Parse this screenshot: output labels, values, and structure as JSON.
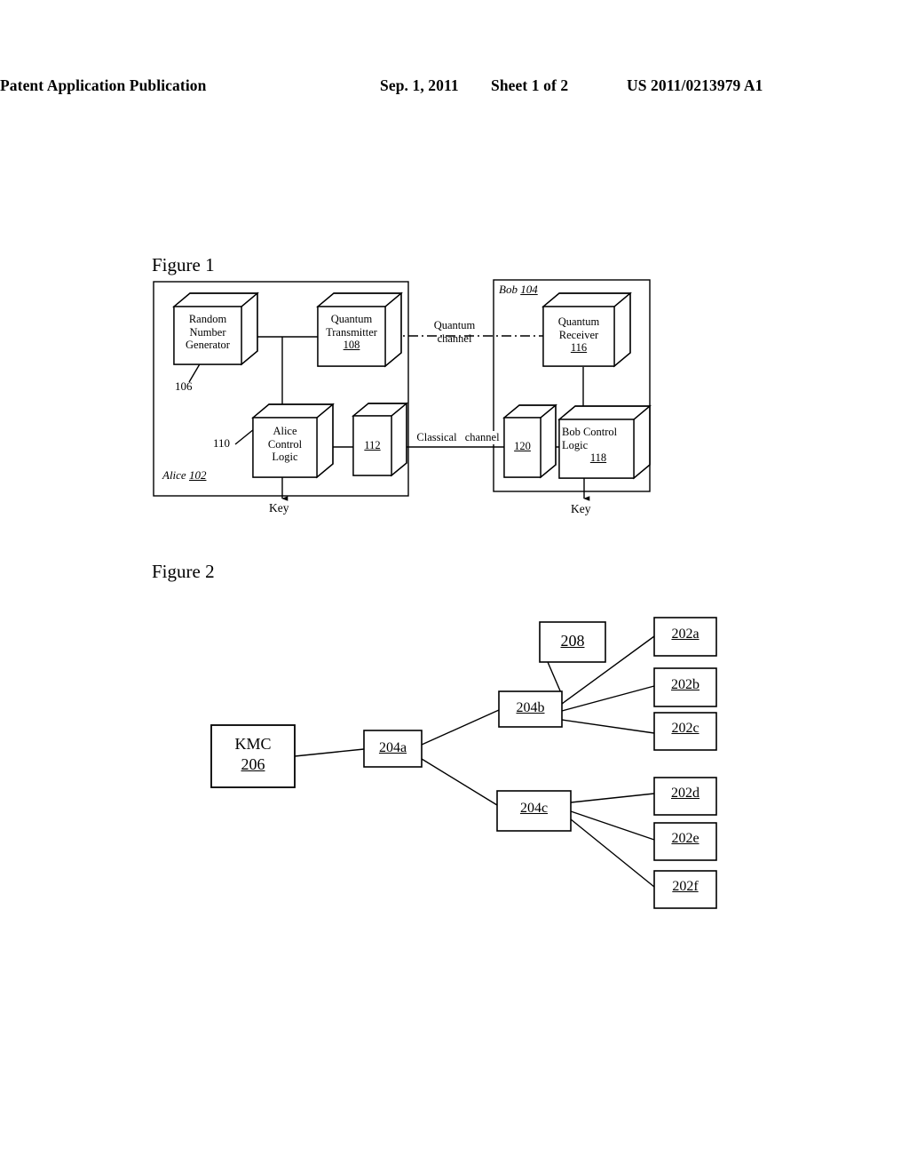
{
  "header": {
    "title": "Patent Application Publication",
    "date": "Sep. 1, 2011",
    "sheet": "Sheet 1 of 2",
    "pub_number": "US 2011/0213979 A1"
  },
  "figure1": {
    "caption": "Figure 1",
    "alice": {
      "party_name": "Alice",
      "party_ref": "102",
      "nodes": [
        {
          "id": "rng",
          "lines": [
            "Random",
            "Number",
            "Generator"
          ],
          "ref": "",
          "callout": "106"
        },
        {
          "id": "qtx",
          "lines": [
            "Quantum",
            "Transmitter"
          ],
          "ref": "108",
          "callout": ""
        },
        {
          "id": "acl",
          "lines": [
            "Alice",
            "Control",
            "Logic"
          ],
          "ref": "",
          "callout": "110"
        },
        {
          "id": "iface112",
          "lines": [],
          "ref": "112",
          "callout": ""
        }
      ],
      "key_label": "Key"
    },
    "bob": {
      "party_name": "Bob",
      "party_ref": "104",
      "nodes": [
        {
          "id": "qrx",
          "lines": [
            "Quantum",
            "Receiver"
          ],
          "ref": "116",
          "callout": ""
        },
        {
          "id": "iface120",
          "lines": [],
          "ref": "120",
          "callout": ""
        },
        {
          "id": "bcl",
          "lines": [
            "Bob Control",
            "Logic"
          ],
          "ref": "118",
          "callout": ""
        }
      ],
      "key_label": "Key"
    },
    "channels": [
      {
        "id": "quantum",
        "line1": "Quantum",
        "line2": "channel",
        "style": "dash-dot"
      },
      {
        "id": "classical",
        "line1": "Classical",
        "line2": "channel",
        "style": "solid"
      }
    ]
  },
  "figure2": {
    "caption": "Figure 2",
    "root": {
      "id": "kmc",
      "line1": "KMC",
      "line2": "206"
    },
    "nodes": [
      {
        "id": "n204a",
        "label": "204a"
      },
      {
        "id": "n204b",
        "label": "204b"
      },
      {
        "id": "n204c",
        "label": "204c"
      },
      {
        "id": "n208",
        "label": "208"
      },
      {
        "id": "n202a",
        "label": "202a"
      },
      {
        "id": "n202b",
        "label": "202b"
      },
      {
        "id": "n202c",
        "label": "202c"
      },
      {
        "id": "n202d",
        "label": "202d"
      },
      {
        "id": "n202e",
        "label": "202e"
      },
      {
        "id": "n202f",
        "label": "202f"
      }
    ]
  },
  "colors": {
    "ink": "#000000",
    "paper": "#ffffff"
  }
}
